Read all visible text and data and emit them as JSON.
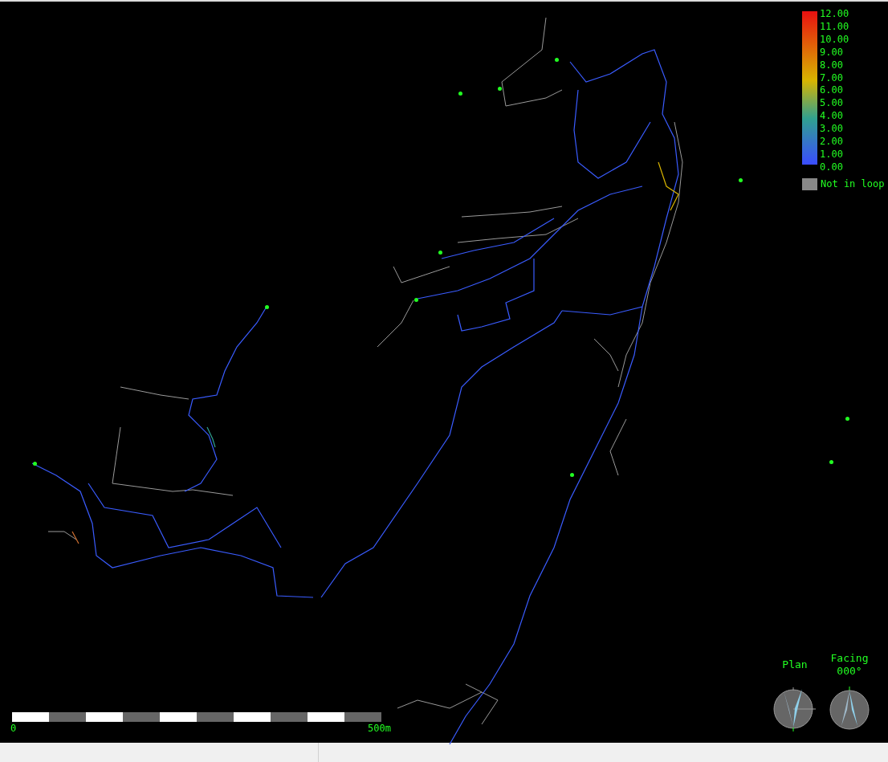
{
  "legend": {
    "ticks": [
      "12.00",
      "11.00",
      "10.00",
      "9.00",
      "8.00",
      "7.00",
      "6.00",
      "5.00",
      "4.00",
      "3.00",
      "2.00",
      "1.00",
      "0.00"
    ],
    "not_in_loop_label": "Not in loop"
  },
  "scale_bar": {
    "start_label": "0",
    "end_label": "500m"
  },
  "compasses": [
    {
      "kind": "plan",
      "label": "Plan"
    },
    {
      "kind": "facing",
      "label": "Facing",
      "bearing": "000°"
    }
  ]
}
